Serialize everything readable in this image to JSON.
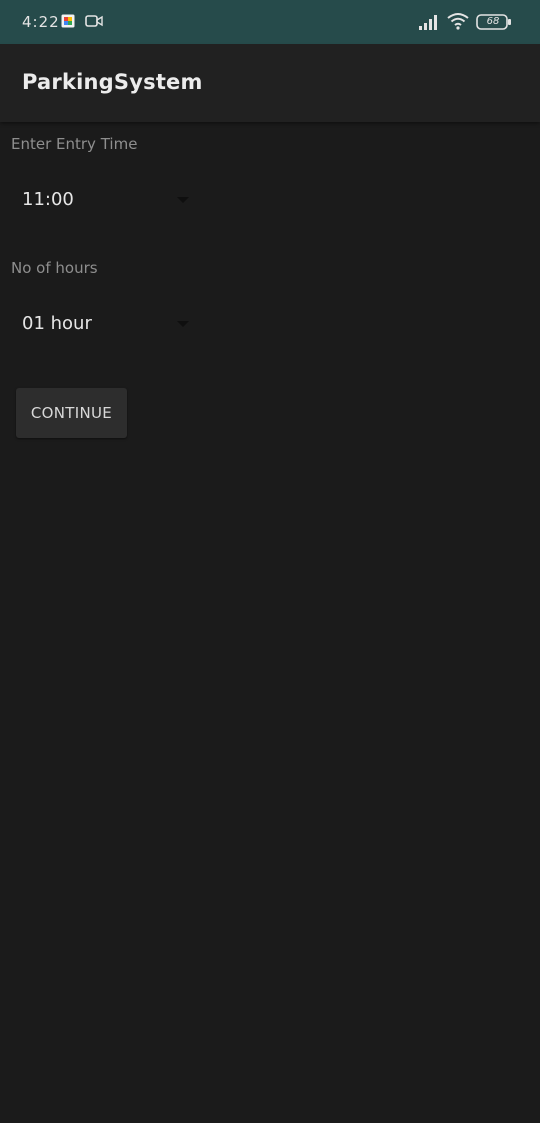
{
  "status_bar": {
    "time": "4:22",
    "battery_level": "68",
    "icons": [
      "photos-icon",
      "video-call-icon",
      "signal-icon",
      "wifi-icon",
      "battery-icon"
    ],
    "background_color": "#264b4b"
  },
  "app_bar": {
    "title": "ParkingSystem"
  },
  "form": {
    "entry_time_label": "Enter Entry Time",
    "entry_time_value": "11:00",
    "hours_label": "No of hours",
    "hours_value": "01 hour",
    "continue_label": "CONTINUE"
  },
  "colors": {
    "background": "#1b1b1b",
    "app_bar": "#212121",
    "button": "#2d2d2d"
  }
}
